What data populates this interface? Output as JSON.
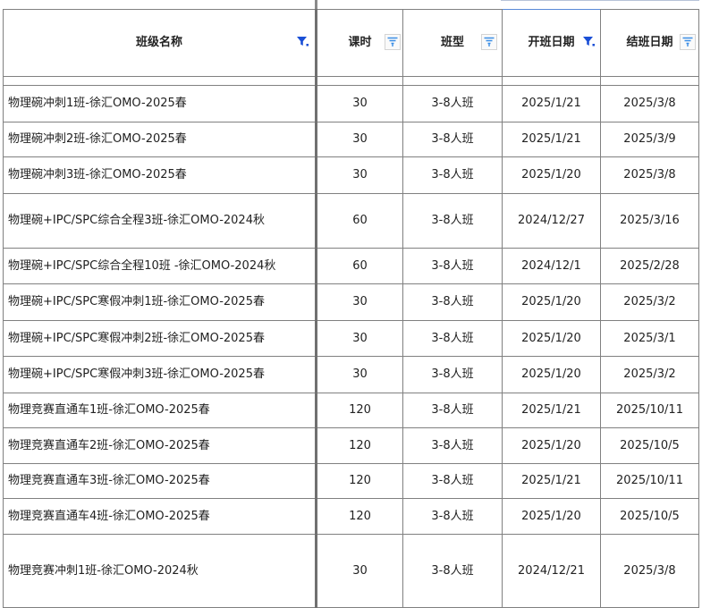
{
  "table": {
    "headers": [
      {
        "label": "班级名称",
        "filter": "active"
      },
      {
        "label": "课时",
        "filter": "inactive"
      },
      {
        "label": "班型",
        "filter": "inactive"
      },
      {
        "label": "开班日期",
        "filter": "active"
      },
      {
        "label": "结班日期",
        "filter": "inactive"
      }
    ],
    "rows": [
      {
        "name": "物理碗冲刺1班-徐汇OMO-2025春",
        "hours": "30",
        "type": "3-8人班",
        "start": "2025/1/21",
        "end": "2025/3/8"
      },
      {
        "name": "物理碗冲刺2班-徐汇OMO-2025春",
        "hours": "30",
        "type": "3-8人班",
        "start": "2025/1/21",
        "end": "2025/3/9"
      },
      {
        "name": "物理碗冲刺3班-徐汇OMO-2025春",
        "hours": "30",
        "type": "3-8人班",
        "start": "2025/1/20",
        "end": "2025/3/8"
      },
      {
        "name": "物理碗+IPC/SPC综合全程3班-徐汇OMO-2024秋",
        "hours": "60",
        "type": "3-8人班",
        "start": "2024/12/27",
        "end": "2025/3/16"
      },
      {
        "name": "物理碗+IPC/SPC综合全程10班 -徐汇OMO-2024秋",
        "hours": "60",
        "type": "3-8人班",
        "start": "2024/12/1",
        "end": "2025/2/28"
      },
      {
        "name": "物理碗+IPC/SPC寒假冲刺1班-徐汇OMO-2025春",
        "hours": "30",
        "type": "3-8人班",
        "start": "2025/1/20",
        "end": "2025/3/2"
      },
      {
        "name": "物理碗+IPC/SPC寒假冲刺2班-徐汇OMO-2025春",
        "hours": "30",
        "type": "3-8人班",
        "start": "2025/1/20",
        "end": "2025/3/1"
      },
      {
        "name": "物理碗+IPC/SPC寒假冲刺3班-徐汇OMO-2025春",
        "hours": "30",
        "type": "3-8人班",
        "start": "2025/1/20",
        "end": "2025/3/2"
      },
      {
        "name": "物理竞赛直通车1班-徐汇OMO-2025春",
        "hours": "120",
        "type": "3-8人班",
        "start": "2025/1/21",
        "end": "2025/10/11"
      },
      {
        "name": "物理竞赛直通车2班-徐汇OMO-2025春",
        "hours": "120",
        "type": "3-8人班",
        "start": "2025/1/20",
        "end": "2025/10/5"
      },
      {
        "name": "物理竞赛直通车3班-徐汇OMO-2025春",
        "hours": "120",
        "type": "3-8人班",
        "start": "2025/1/21",
        "end": "2025/10/11"
      },
      {
        "name": "物理竞赛直通车4班-徐汇OMO-2025春",
        "hours": "120",
        "type": "3-8人班",
        "start": "2025/1/20",
        "end": "2025/10/5"
      },
      {
        "name": "物理竞赛冲刺1班-徐汇OMO-2024秋",
        "hours": "30",
        "type": "3-8人班",
        "start": "2024/12/21",
        "end": "2025/3/8"
      }
    ]
  },
  "colors": {
    "filter_active": "#1a4fd6",
    "filter_inactive": "#3a8ee6",
    "border": "#808080"
  }
}
